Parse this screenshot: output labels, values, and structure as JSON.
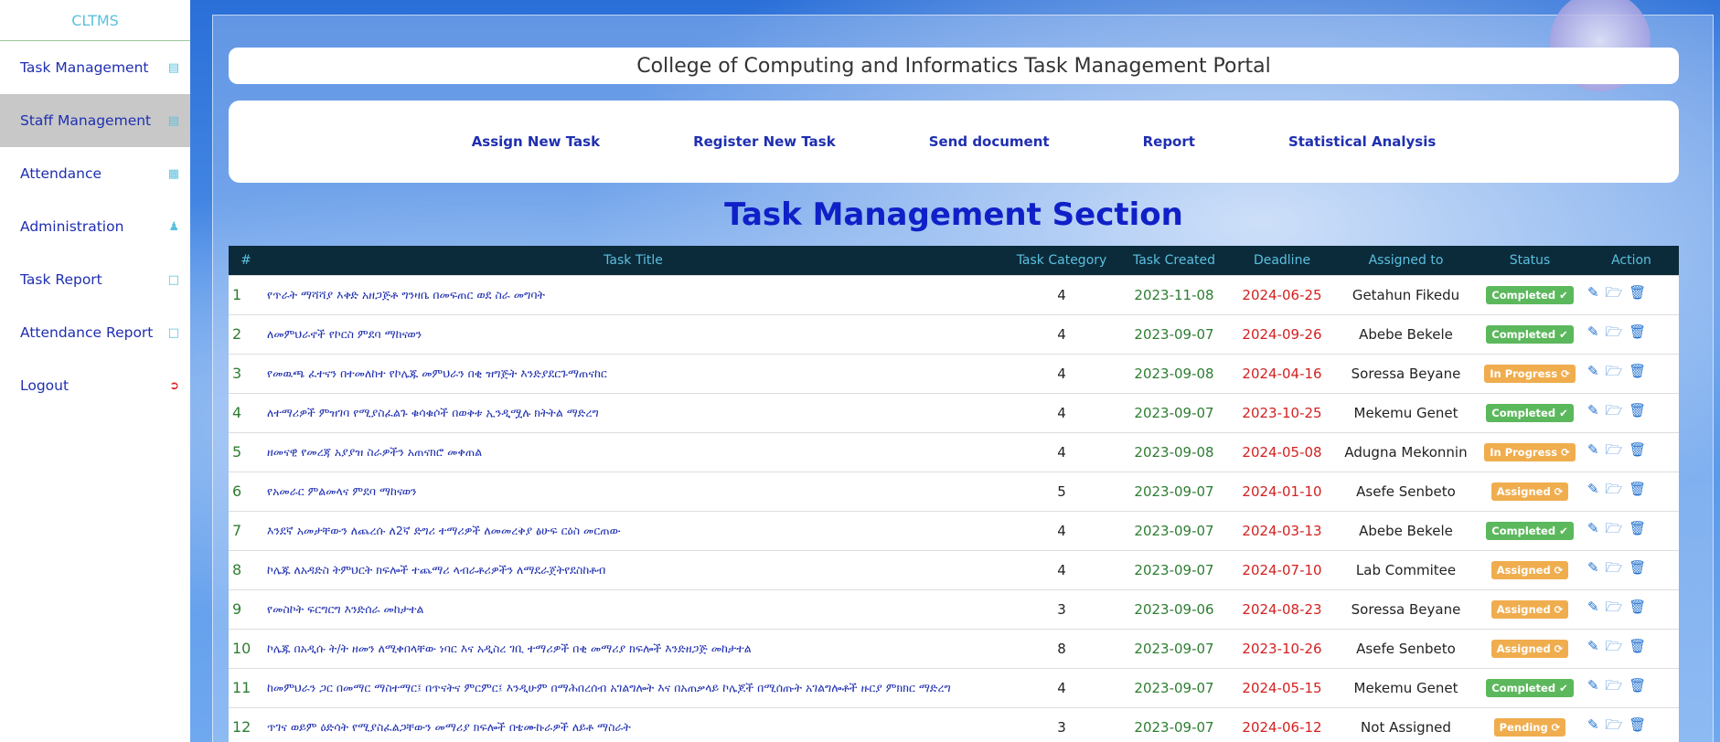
{
  "sidebar": {
    "brand": "CLTMS",
    "items": [
      {
        "label": "Task Management",
        "icon": "task-list-icon"
      },
      {
        "label": "Staff Management",
        "icon": "staff-list-icon"
      },
      {
        "label": "Attendance",
        "icon": "calendar-icon"
      },
      {
        "label": "Administration",
        "icon": "user-icon"
      },
      {
        "label": "Task Report",
        "icon": "document-icon"
      },
      {
        "label": "Attendance Report",
        "icon": "document-icon"
      },
      {
        "label": "Logout",
        "icon": "logout-icon"
      }
    ]
  },
  "header": {
    "title": "College of Computing and Informatics Task Management Portal"
  },
  "links": [
    "Assign New Task",
    "Register New Task",
    "Send document",
    "Report",
    "Statistical Analysis"
  ],
  "section_title": "Task Management Section",
  "table": {
    "headers": [
      "#",
      "Task Title",
      "Task Category",
      "Task Created",
      "Deadline",
      "Assigned to",
      "Status",
      "Action"
    ],
    "rows": [
      {
        "num": "1",
        "title": "የጥራት ማሻሻያ እቅድ አዘጋጅቶ ግንዛቤ በመፍጠር ወደ ስራ መግባት",
        "category": "4",
        "created": "2023-11-08",
        "deadline": "2024-06-25",
        "assigned": "Getahun Fikedu",
        "status": "Completed ✔",
        "status_type": "completed"
      },
      {
        "num": "2",
        "title": "ለመምህራኖች የኮርስ ምደባ ማከናወን",
        "category": "4",
        "created": "2023-09-07",
        "deadline": "2024-09-26",
        "assigned": "Abebe Bekele",
        "status": "Completed ✔",
        "status_type": "completed"
      },
      {
        "num": "3",
        "title": "የመዉጫ ፈተናን በተመለከተ የኮሌጁ መምህራን በቂ ዝግጅት እንድያደርጉማጠናከር",
        "category": "4",
        "created": "2023-09-08",
        "deadline": "2024-04-16",
        "assigned": "Soressa Beyane",
        "status": "In Progress ⟳",
        "status_type": "progress"
      },
      {
        "num": "4",
        "title": "ለተማሪዎች ምዝገባ የሚያስፈልጉ ቁሳቁሶች በወቅቱ ኢንዲሟሉ ክትትል ማድረግ",
        "category": "4",
        "created": "2023-09-07",
        "deadline": "2023-10-25",
        "assigned": "Mekemu Genet",
        "status": "Completed ✔",
        "status_type": "completed"
      },
      {
        "num": "5",
        "title": "ዘመናዊ የመረጃ አያያዝ ስራዎችን አጠናክሮ መቀጠል",
        "category": "4",
        "created": "2023-09-08",
        "deadline": "2024-05-08",
        "assigned": "Adugna Mekonnin",
        "status": "In Progress ⟳",
        "status_type": "progress"
      },
      {
        "num": "6",
        "title": "የአመራር ምልመላና ምደባ ማከናወን",
        "category": "5",
        "created": "2023-09-07",
        "deadline": "2024-01-10",
        "assigned": "Asefe Senbeto",
        "status": "Assigned ⟳",
        "status_type": "progress"
      },
      {
        "num": "7",
        "title": "እንደኛ አመታቸውን ለጨረሱ ለ2ኛ ድግሪ ተማሪዎች ለመመረቅያ ፅሁፍ ርዕስ መርጠው",
        "category": "4",
        "created": "2023-09-07",
        "deadline": "2024-03-13",
        "assigned": "Abebe Bekele",
        "status": "Completed ✔",
        "status_type": "completed"
      },
      {
        "num": "8",
        "title": "ኮሌጁ ለአዳድስ ትምህርት ክፍሎች ተጨማሪ ላብራቶሪዎችን ለማደራጀትየደስከቶብ",
        "category": "4",
        "created": "2023-09-07",
        "deadline": "2024-07-10",
        "assigned": "Lab Commitee",
        "status": "Assigned ⟳",
        "status_type": "progress"
      },
      {
        "num": "9",
        "title": "የመስኮት ፍርግርግ እንድሰራ መከታተል",
        "category": "3",
        "created": "2023-09-06",
        "deadline": "2024-08-23",
        "assigned": "Soressa Beyane",
        "status": "Assigned ⟳",
        "status_type": "progress"
      },
      {
        "num": "10",
        "title": "ኮሌጁ በአዲሱ ት/ት ዘመን ለሚቀበላቸው ነባር እና አዲስረ ገቢ ተማሪዎች በቂ መማሪያ ክፍሎች እንድዘጋጅ መከታተል",
        "category": "8",
        "created": "2023-09-07",
        "deadline": "2023-10-26",
        "assigned": "Asefe Senbeto",
        "status": "Assigned ⟳",
        "status_type": "progress"
      },
      {
        "num": "11",
        "title": "ከመምህራን ጋር በመማር ማስተማር፤ በጥናትና ምርምር፤ እንዲሁም በማሕበረሰብ አገልግሎት እና በአጠቃላይ ኮሌጆች በሚሰጡት አገልግሎቶች ዙርያ ምክክር ማድረግ",
        "category": "4",
        "created": "2023-09-07",
        "deadline": "2024-05-15",
        "assigned": "Mekemu Genet",
        "status": "Completed ✔",
        "status_type": "completed"
      },
      {
        "num": "12",
        "title": "ጥገና ወይም ዕድሳት የሚያስፈልጋቸውን መማሪያ ክፍሎች በቴሙኩራዎች ለይቶ ማስራት",
        "category": "3",
        "created": "2023-09-07",
        "deadline": "2024-06-12",
        "assigned": "Not Assigned",
        "status": "Pending ⟳",
        "status_type": "progress"
      }
    ]
  },
  "action_icons": [
    "edit-icon",
    "folder-icon",
    "trash-icon"
  ],
  "colors": {
    "brand": "#5bc0de",
    "link": "#1f2fb0",
    "header_bg": "#0b2a3a",
    "completed": "#5cb85c",
    "in_progress": "#f0ad4e",
    "deadline": "#d42020",
    "created": "#2e7d32"
  }
}
